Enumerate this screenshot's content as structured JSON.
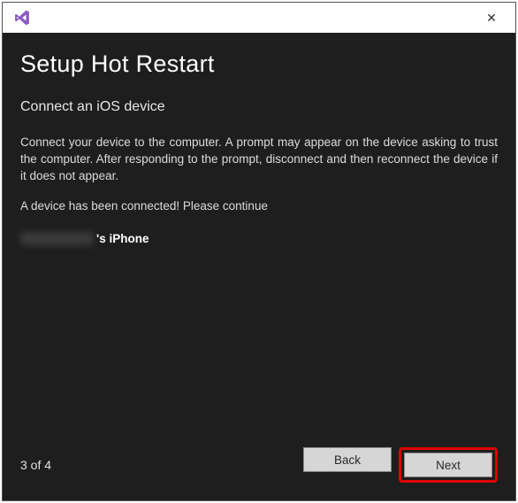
{
  "titlebar": {
    "logo_name": "visual-studio-logo",
    "close_label": "✕"
  },
  "page_title": "Setup Hot Restart",
  "subtitle": "Connect an iOS device",
  "instructions": "Connect your device to the computer. A prompt may appear on the device asking to trust the computer. After responding to the prompt, disconnect and then reconnect the device if it does not appear.",
  "status": "A device has been connected! Please continue",
  "device": {
    "suffix": "'s iPhone"
  },
  "footer": {
    "page_indicator": "3 of 4",
    "back_label": "Back",
    "next_label": "Next"
  }
}
